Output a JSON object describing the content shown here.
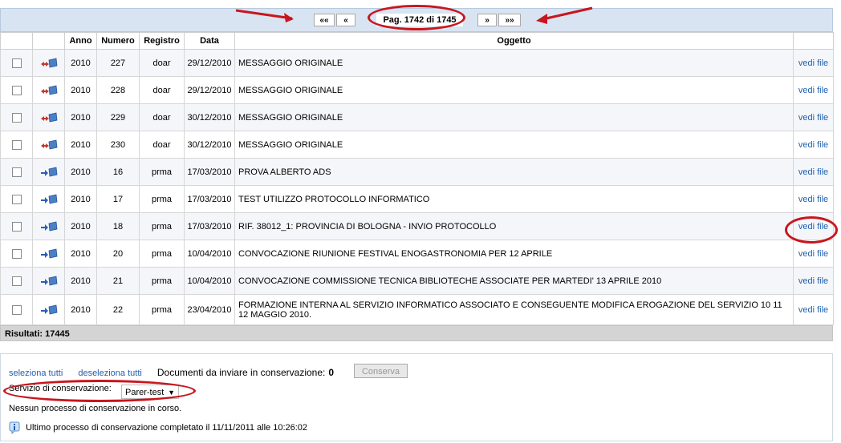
{
  "pager": {
    "first": "««",
    "prev": "«",
    "label": "Pag. 1742 di 1745",
    "next": "»",
    "last": "»»"
  },
  "columns": [
    "Anno",
    "Numero",
    "Registro",
    "Data",
    "Oggetto"
  ],
  "rows": [
    {
      "anno": "2010",
      "numero": "227",
      "registro": "doar",
      "data": "29/12/2010",
      "oggetto": "MESSAGGIO ORIGINALE",
      "link": "vedi file",
      "dir": "bidirectional"
    },
    {
      "anno": "2010",
      "numero": "228",
      "registro": "doar",
      "data": "29/12/2010",
      "oggetto": "MESSAGGIO ORIGINALE",
      "link": "vedi file",
      "dir": "bidirectional"
    },
    {
      "anno": "2010",
      "numero": "229",
      "registro": "doar",
      "data": "30/12/2010",
      "oggetto": "MESSAGGIO ORIGINALE",
      "link": "vedi file",
      "dir": "bidirectional"
    },
    {
      "anno": "2010",
      "numero": "230",
      "registro": "doar",
      "data": "30/12/2010",
      "oggetto": "MESSAGGIO ORIGINALE",
      "link": "vedi file",
      "dir": "bidirectional"
    },
    {
      "anno": "2010",
      "numero": "16",
      "registro": "prma",
      "data": "17/03/2010",
      "oggetto": "PROVA ALBERTO ADS",
      "link": "vedi file",
      "dir": "outgoing"
    },
    {
      "anno": "2010",
      "numero": "17",
      "registro": "prma",
      "data": "17/03/2010",
      "oggetto": "TEST UTILIZZO PROTOCOLLO INFORMATICO",
      "link": "vedi file",
      "dir": "outgoing"
    },
    {
      "anno": "2010",
      "numero": "18",
      "registro": "prma",
      "data": "17/03/2010",
      "oggetto": "RIF. 38012_1: PROVINCIA DI BOLOGNA - INVIO PROTOCOLLO",
      "link": "vedi file",
      "dir": "outgoing"
    },
    {
      "anno": "2010",
      "numero": "20",
      "registro": "prma",
      "data": "10/04/2010",
      "oggetto": "CONVOCAZIONE RIUNIONE FESTIVAL ENOGASTRONOMIA PER 12 APRILE",
      "link": "vedi file",
      "dir": "outgoing"
    },
    {
      "anno": "2010",
      "numero": "21",
      "registro": "prma",
      "data": "10/04/2010",
      "oggetto": "CONVOCAZIONE COMMISSIONE TECNICA BIBLIOTECHE ASSOCIATE PER MARTEDI' 13 APRILE 2010",
      "link": "vedi file",
      "dir": "outgoing"
    },
    {
      "anno": "2010",
      "numero": "22",
      "registro": "prma",
      "data": "23/04/2010",
      "oggetto": "FORMAZIONE INTERNA AL SERVIZIO INFORMATICO ASSOCIATO E CONSEGUENTE MODIFICA EROGAZIONE DEL SERVIZIO 10 11 12 MAGGIO 2010.",
      "link": "vedi file",
      "dir": "outgoing"
    }
  ],
  "results_label": "Risultati: 17445",
  "bottom": {
    "select_all": "seleziona tutti",
    "deselect_all": "deseleziona tutti",
    "docs_label": "Documenti da inviare in conservazione:",
    "docs_count": "0",
    "conserva_button": "Conserva",
    "service_label": "Servizio di conservazione:",
    "service_value": "Parer-test",
    "status_line": "Nessun processo di conservazione in corso.",
    "last_process": "Ultimo processo di conservazione completato il 11/11/2011 alle 10:26:02"
  },
  "colors": {
    "pager_bg": "#d8e4f2",
    "link": "#1f5fb0",
    "annotation": "#c8161d",
    "results_bg": "#d4d4d4"
  }
}
